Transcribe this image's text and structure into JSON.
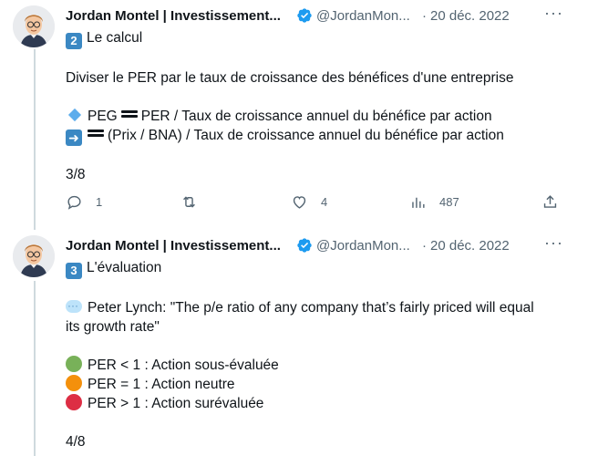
{
  "tweets": [
    {
      "author_name": "Jordan Montel | Investissement...",
      "handle": "@JordanMon...",
      "separator": "·",
      "date": "20 déc. 2022",
      "heading_key": "2",
      "heading": "Le calcul",
      "lines": [
        "Diviser le PER par le taux de croissance des bénéfices d'une entreprise",
        "PEG",
        "PER / Taux de croissance annuel du bénéfice par action",
        "(Prix / BNA) / Taux de croissance annuel du bénéfice par action"
      ],
      "counter": "3/8",
      "stats": {
        "replies": "1",
        "retweets": "",
        "likes": "4",
        "views": "487"
      }
    },
    {
      "author_name": "Jordan Montel | Investissement...",
      "handle": "@JordanMon...",
      "separator": "·",
      "date": "20 déc. 2022",
      "heading_key": "3",
      "heading": "L'évaluation",
      "quote_line1": "Peter Lynch: \"The p/e ratio of any company that’s fairly priced will equal",
      "quote_line2": "its growth rate\"",
      "rules": [
        {
          "text": "PER < 1 : Action sous-évaluée",
          "color": "#78b159"
        },
        {
          "text": "PER = 1 : Action neutre",
          "color": "#f4900c"
        },
        {
          "text": "PER > 1 : Action surévaluée",
          "color": "#dd2e44"
        }
      ],
      "counter": "4/8"
    }
  ],
  "colors": {
    "verified": "#1d9bf0",
    "muted": "#536471",
    "thread_line": "#cfd9de"
  },
  "icons": [
    "verified-badge-icon",
    "more-icon",
    "reply-icon",
    "retweet-icon",
    "like-icon",
    "views-icon",
    "share-icon"
  ]
}
